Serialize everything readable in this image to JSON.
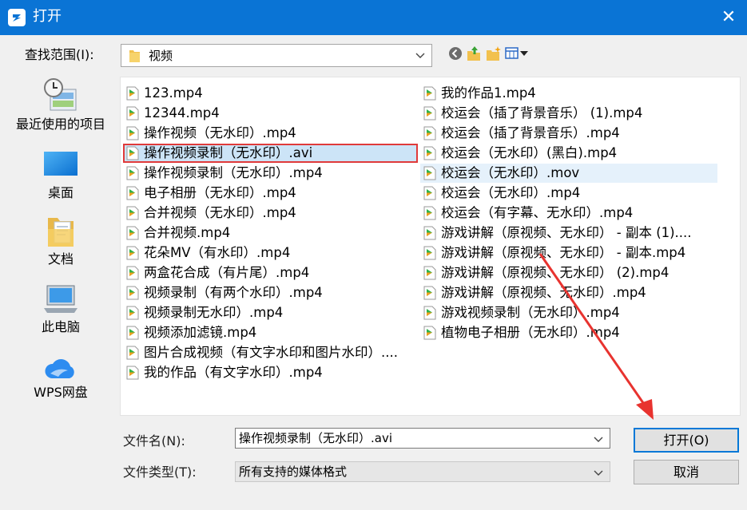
{
  "window": {
    "title": "打开",
    "close_glyph": "✕",
    "titlebar_color": "#0a74d5"
  },
  "lookin": {
    "label": "查找范围(I):",
    "value": "视频"
  },
  "toolbar": {
    "icons": [
      "back-icon",
      "up-folder-icon",
      "new-folder-icon",
      "view-menu-icon"
    ]
  },
  "places": [
    {
      "label": "最近使用的项目",
      "icon": "recent-items-icon"
    },
    {
      "label": "桌面",
      "icon": "desktop-icon"
    },
    {
      "label": "文档",
      "icon": "documents-icon"
    },
    {
      "label": "此电脑",
      "icon": "this-pc-icon"
    },
    {
      "label": "WPS网盘",
      "icon": "wps-cloud-icon"
    }
  ],
  "files": {
    "left": [
      "123.mp4",
      "12344.mp4",
      "操作视频（无水印）.mp4",
      "操作视频录制（无水印）.avi",
      "操作视频录制（无水印）.mp4",
      "电子相册（无水印）.mp4",
      "合并视频（无水印）.mp4",
      "合并视频.mp4",
      "花朵MV（有水印）.mp4",
      "两盒花合成（有片尾）.mp4",
      "视频录制（有两个水印）.mp4",
      "视频录制无水印）.mp4",
      "视频添加滤镜.mp4",
      "图片合成视频（有文字水印和图片水印）....",
      "我的作品（有文字水印）.mp4"
    ],
    "right": [
      "我的作品1.mp4",
      "校运会（插了背景音乐） (1).mp4",
      "校运会（插了背景音乐）.mp4",
      "校运会（无水印）(黑白).mp4",
      "校运会（无水印）.mov",
      "校运会（无水印）.mp4",
      "校运会（有字幕、无水印）.mp4",
      "游戏讲解（原视频、无水印） - 副本 (1)....",
      "游戏讲解（原视频、无水印） - 副本.mp4",
      "游戏讲解（原视频、无水印） (2).mp4",
      "游戏讲解（原视频、无水印）.mp4",
      "游戏视频录制（无水印）.mp4",
      "植物电子相册（无水印）.mp4"
    ],
    "selected": "操作视频录制（无水印）.avi",
    "hovered": "校运会（无水印）.mov"
  },
  "filename": {
    "label": "文件名(N):",
    "value": "操作视频录制（无水印）.avi"
  },
  "filetype": {
    "label": "文件类型(T):",
    "value": "所有支持的媒体格式"
  },
  "buttons": {
    "open": "打开(O)",
    "cancel": "取消"
  },
  "colors": {
    "selection_outline": "#e03a3a",
    "annotation_arrow": "#e8332f",
    "file_icon_green": "#2fb34a"
  }
}
